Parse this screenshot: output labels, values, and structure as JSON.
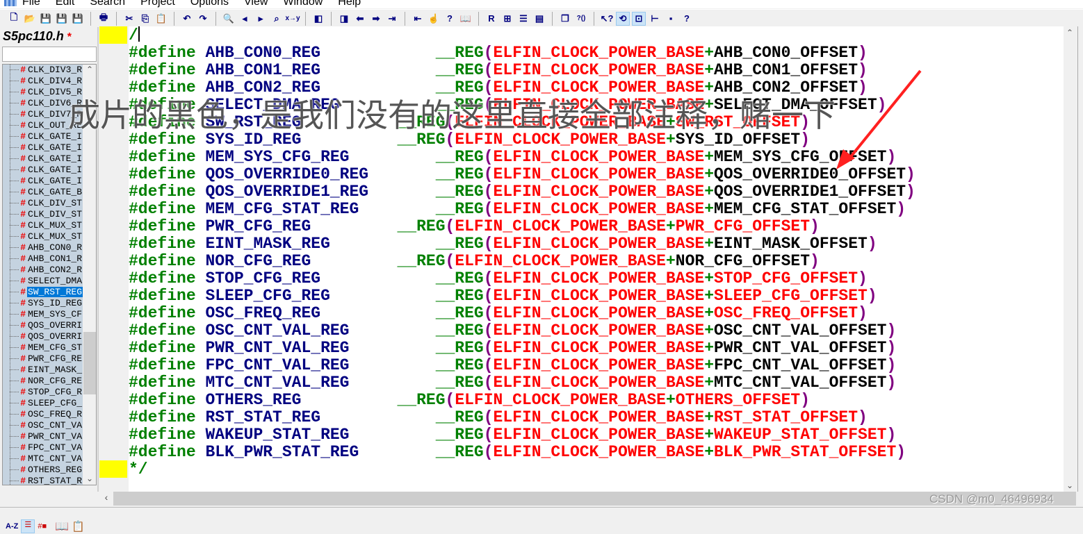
{
  "menu": [
    "File",
    "Edit",
    "Search",
    "Project",
    "Options",
    "View",
    "Window",
    "Help"
  ],
  "toolbar_icons": [
    "new-file",
    "open",
    "save",
    "save-as",
    "save-all",
    "print",
    "cut",
    "copy",
    "paste",
    "undo",
    "redo",
    "find",
    "find-prev",
    "find-next",
    "find-files",
    "replace",
    "bookmark-prev",
    "bookmark-next",
    "back",
    "forward",
    "indent",
    "outdent",
    "jump",
    "symbol-info",
    "browse",
    "relation",
    "tile",
    "split-h",
    "split-v",
    "cascade",
    "help-func",
    "help-pointer",
    "toggle-sync",
    "context",
    "tree",
    "layout",
    "help-index"
  ],
  "sidebar": {
    "file_title": "S5pc110.h",
    "modified_mark": "*",
    "filter_value": "",
    "symbols": [
      "CLK_DIV3_R",
      "CLK_DIV4_R",
      "CLK_DIV5_R",
      "CLK_DIV6_R",
      "CLK_DIV7_R",
      "CLK_OUT_RE",
      "CLK_GATE_I",
      "CLK_GATE_I",
      "CLK_GATE_I",
      "CLK_GATE_I",
      "CLK_GATE_I",
      "CLK_GATE_B",
      "CLK_DIV_ST",
      "CLK_DIV_ST",
      "CLK_MUX_ST",
      "CLK_MUX_ST",
      "AHB_CON0_R",
      "AHB_CON1_R",
      "AHB_CON2_R",
      "SELECT_DMA",
      "SW_RST_REG",
      "SYS_ID_REG",
      "MEM_SYS_CF",
      "QOS_OVERRI",
      "QOS_OVERRI",
      "MEM_CFG_ST",
      "PWR_CFG_RE",
      "EINT_MASK_",
      "NOR_CFG_RE",
      "STOP_CFG_R",
      "SLEEP_CFG_",
      "OSC_FREQ_R",
      "OSC_CNT_VA",
      "PWR_CNT_VA",
      "FPC_CNT_VA",
      "MTC_CNT_VA",
      "OTHERS_REG",
      "RST_STAT_R"
    ],
    "selected_symbol": "SW_RST_REG",
    "tabs": [
      "A-Z",
      "list",
      "symbols",
      "book",
      "properties"
    ]
  },
  "editor": {
    "first_line": "/",
    "last_line": "*/",
    "keyword": "#define",
    "macro": "__REG",
    "base": "ELFIN_CLOCK_POWER_BASE",
    "lines": [
      {
        "name": "AHB_CON0_REG",
        "offset": "AHB_CON0_OFFSET",
        "short": false,
        "red": false
      },
      {
        "name": "AHB_CON1_REG",
        "offset": "AHB_CON1_OFFSET",
        "short": false,
        "red": false
      },
      {
        "name": "AHB_CON2_REG",
        "offset": "AHB_CON2_OFFSET",
        "short": false,
        "red": false
      },
      {
        "name": "SELECT_DMA_REG",
        "offset": "SELECT_DMA_OFFSET",
        "short": false,
        "red": false
      },
      {
        "name": "SW_RST_REG",
        "offset": "SW_RST_OFFSET",
        "short": true,
        "red": true
      },
      {
        "name": "SYS_ID_REG",
        "offset": "SYS_ID_OFFSET",
        "short": true,
        "red": false
      },
      {
        "name": "MEM_SYS_CFG_REG",
        "offset": "MEM_SYS_CFG_OFFSET",
        "short": false,
        "red": false
      },
      {
        "name": "QOS_OVERRIDE0_REG",
        "offset": "QOS_OVERRIDE0_OFFSET",
        "short": false,
        "red": false
      },
      {
        "name": "QOS_OVERRIDE1_REG",
        "offset": "QOS_OVERRIDE1_OFFSET",
        "short": false,
        "red": false
      },
      {
        "name": "MEM_CFG_STAT_REG",
        "offset": "MEM_CFG_STAT_OFFSET",
        "short": false,
        "red": false
      },
      {
        "name": "PWR_CFG_REG",
        "offset": "PWR_CFG_OFFSET",
        "short": true,
        "red": true
      },
      {
        "name": "EINT_MASK_REG",
        "offset": "EINT_MASK_OFFSET",
        "short": false,
        "red": false
      },
      {
        "name": "NOR_CFG_REG",
        "offset": "NOR_CFG_OFFSET",
        "short": true,
        "red": false
      },
      {
        "name": "STOP_CFG_REG",
        "offset": "STOP_CFG_OFFSET",
        "short": false,
        "red": true
      },
      {
        "name": "SLEEP_CFG_REG",
        "offset": "SLEEP_CFG_OFFSET",
        "short": false,
        "red": true
      },
      {
        "name": "OSC_FREQ_REG",
        "offset": "OSC_FREQ_OFFSET",
        "short": false,
        "red": true
      },
      {
        "name": "OSC_CNT_VAL_REG",
        "offset": "OSC_CNT_VAL_OFFSET",
        "short": false,
        "red": false
      },
      {
        "name": "PWR_CNT_VAL_REG",
        "offset": "PWR_CNT_VAL_OFFSET",
        "short": false,
        "red": false
      },
      {
        "name": "FPC_CNT_VAL_REG",
        "offset": "FPC_CNT_VAL_OFFSET",
        "short": false,
        "red": false
      },
      {
        "name": "MTC_CNT_VAL_REG",
        "offset": "MTC_CNT_VAL_OFFSET",
        "short": false,
        "red": false
      },
      {
        "name": "OTHERS_REG",
        "offset": "OTHERS_OFFSET",
        "short": true,
        "red": true
      },
      {
        "name": "RST_STAT_REG",
        "offset": "RST_STAT_OFFSET",
        "short": false,
        "red": true
      },
      {
        "name": "WAKEUP_STAT_REG",
        "offset": "WAKEUP_STAT_OFFSET",
        "short": false,
        "red": true
      },
      {
        "name": "BLK_PWR_STAT_REG",
        "offset": "BLK_PWR_STAT_OFFSET",
        "short": false,
        "red": true
      }
    ]
  },
  "annotation": {
    "text": "成片的黑色，是我们没有的这里直接全部注释，赌一下",
    "arrow_color": "#ff2020"
  },
  "watermark": "CSDN @m0_46496934"
}
